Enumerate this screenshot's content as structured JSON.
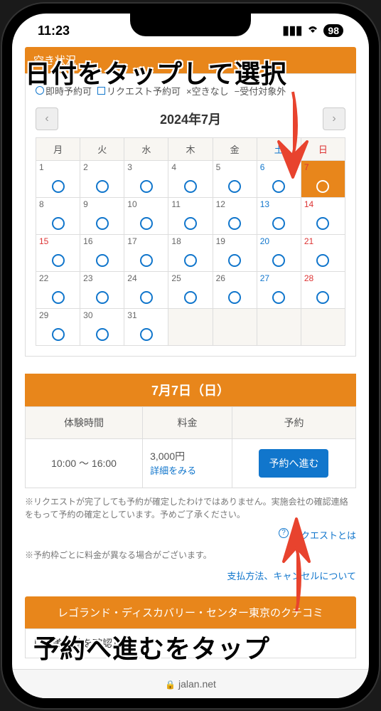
{
  "status": {
    "time": "11:23",
    "battery": "98"
  },
  "section_title": "空き状況",
  "legend": {
    "instant": "即時予約可",
    "request": "リクエスト予約可",
    "none": "×空きなし",
    "outside": "−受付対象外"
  },
  "month_title": "2024年7月",
  "weekdays": [
    "月",
    "火",
    "水",
    "木",
    "金",
    "土",
    "日"
  ],
  "calendar": [
    [
      {
        "d": "1",
        "a": true
      },
      {
        "d": "2",
        "a": true
      },
      {
        "d": "3",
        "a": true
      },
      {
        "d": "4",
        "a": true
      },
      {
        "d": "5",
        "a": true
      },
      {
        "d": "6",
        "a": true,
        "sat": true
      },
      {
        "d": "7",
        "a": true,
        "sun": true,
        "sel": true
      }
    ],
    [
      {
        "d": "8",
        "a": true
      },
      {
        "d": "9",
        "a": true
      },
      {
        "d": "10",
        "a": true
      },
      {
        "d": "11",
        "a": true
      },
      {
        "d": "12",
        "a": true
      },
      {
        "d": "13",
        "a": true,
        "sat": true
      },
      {
        "d": "14",
        "a": true,
        "sun": true
      }
    ],
    [
      {
        "d": "15",
        "a": true,
        "hol": true
      },
      {
        "d": "16",
        "a": true
      },
      {
        "d": "17",
        "a": true
      },
      {
        "d": "18",
        "a": true
      },
      {
        "d": "19",
        "a": true
      },
      {
        "d": "20",
        "a": true,
        "sat": true
      },
      {
        "d": "21",
        "a": true,
        "sun": true
      }
    ],
    [
      {
        "d": "22",
        "a": true
      },
      {
        "d": "23",
        "a": true
      },
      {
        "d": "24",
        "a": true
      },
      {
        "d": "25",
        "a": true
      },
      {
        "d": "26",
        "a": true
      },
      {
        "d": "27",
        "a": true,
        "sat": true
      },
      {
        "d": "28",
        "a": true,
        "sun": true
      }
    ],
    [
      {
        "d": "29",
        "a": true
      },
      {
        "d": "30",
        "a": true
      },
      {
        "d": "31",
        "a": true
      },
      {
        "d": "",
        "e": true
      },
      {
        "d": "",
        "e": true
      },
      {
        "d": "",
        "e": true
      },
      {
        "d": "",
        "e": true
      }
    ]
  ],
  "selected_date_header": "7月7日（日）",
  "booking": {
    "headers": {
      "time": "体験時間",
      "price": "料金",
      "reserve": "予約"
    },
    "row": {
      "time": "10:00 ～ 16:00",
      "price": "3,000円",
      "detail": "詳細をみる",
      "button": "予約へ進む"
    }
  },
  "notes": {
    "n1": "※リクエストが完了しても予約が確定したわけではありません。実施会社の確認連絡をもって予約の確定としています。予めご了承ください。",
    "n2": "※予約枠ごとに料金が異なる場合がございます。"
  },
  "links": {
    "request_info": "リクエストとは",
    "payment_info": "支払方法、キャンセルについて"
  },
  "review_title": "レゴランド・ディスカバリー・センター東京のクチコミ",
  "bottom_text": "レゴ美術館を確認し",
  "url": "jalan.net",
  "annotations": {
    "top": "日付をタップして選択",
    "bottom": "予約へ進むをタップ"
  }
}
